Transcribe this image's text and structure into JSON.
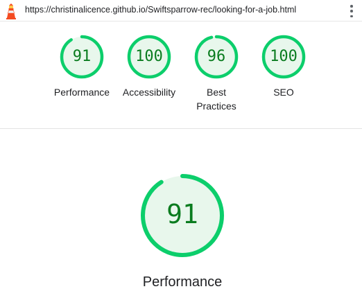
{
  "browser": {
    "url": "https://christinalicence.github.io/Swiftsparrow-rec/looking-for-a-job.html",
    "menu_icon": "kebab-menu-icon"
  },
  "colors": {
    "pass": "#0cce6b",
    "pass_text": "#0a7c1f",
    "pass_fill": "#e8f7ec",
    "divider": "#e3e3e3"
  },
  "gauges": [
    {
      "label": "Performance",
      "score": "91",
      "value": 91
    },
    {
      "label": "Accessibility",
      "score": "100",
      "value": 100
    },
    {
      "label": "Best Practices",
      "score": "96",
      "value": 96
    },
    {
      "label": "SEO",
      "score": "100",
      "value": 100
    }
  ],
  "featured": {
    "label": "Performance",
    "score": "91",
    "value": 91
  }
}
